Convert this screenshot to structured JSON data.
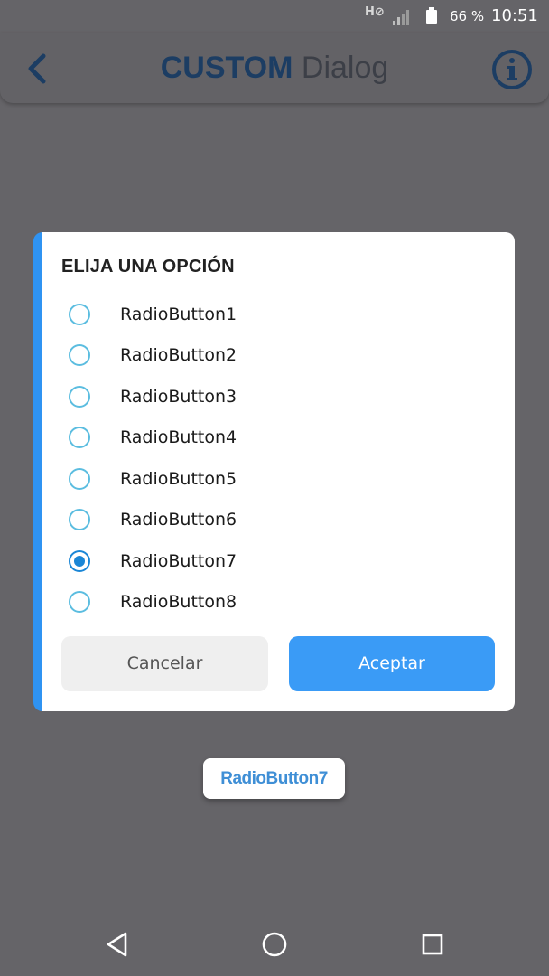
{
  "status_bar": {
    "network_label": "H",
    "battery_percent": "66 %",
    "time": "10:51",
    "icons": [
      "hd-icon",
      "signal-icon",
      "battery-icon"
    ]
  },
  "toolbar": {
    "title_bold": "CUSTOM",
    "title_rest": " Dialog",
    "back_icon": "chevron-left-icon",
    "info_icon": "info-icon",
    "accent_color": "#1c3d63"
  },
  "dialog": {
    "title": "ELIJA UNA OPCIÓN",
    "options": [
      {
        "label": "RadioButton1",
        "checked": false
      },
      {
        "label": "RadioButton2",
        "checked": false
      },
      {
        "label": "RadioButton3",
        "checked": false
      },
      {
        "label": "RadioButton4",
        "checked": false
      },
      {
        "label": "RadioButton5",
        "checked": false
      },
      {
        "label": "RadioButton6",
        "checked": false
      },
      {
        "label": "RadioButton7",
        "checked": true
      },
      {
        "label": "RadioButton8",
        "checked": false
      }
    ],
    "cancel_label": "Cancelar",
    "accept_label": "Aceptar",
    "accent_color": "#2f93f2"
  },
  "toast": {
    "text": "RadioButton7"
  },
  "nav_bar": {
    "icons": [
      "back-triangle-icon",
      "home-circle-icon",
      "recents-square-icon"
    ]
  }
}
